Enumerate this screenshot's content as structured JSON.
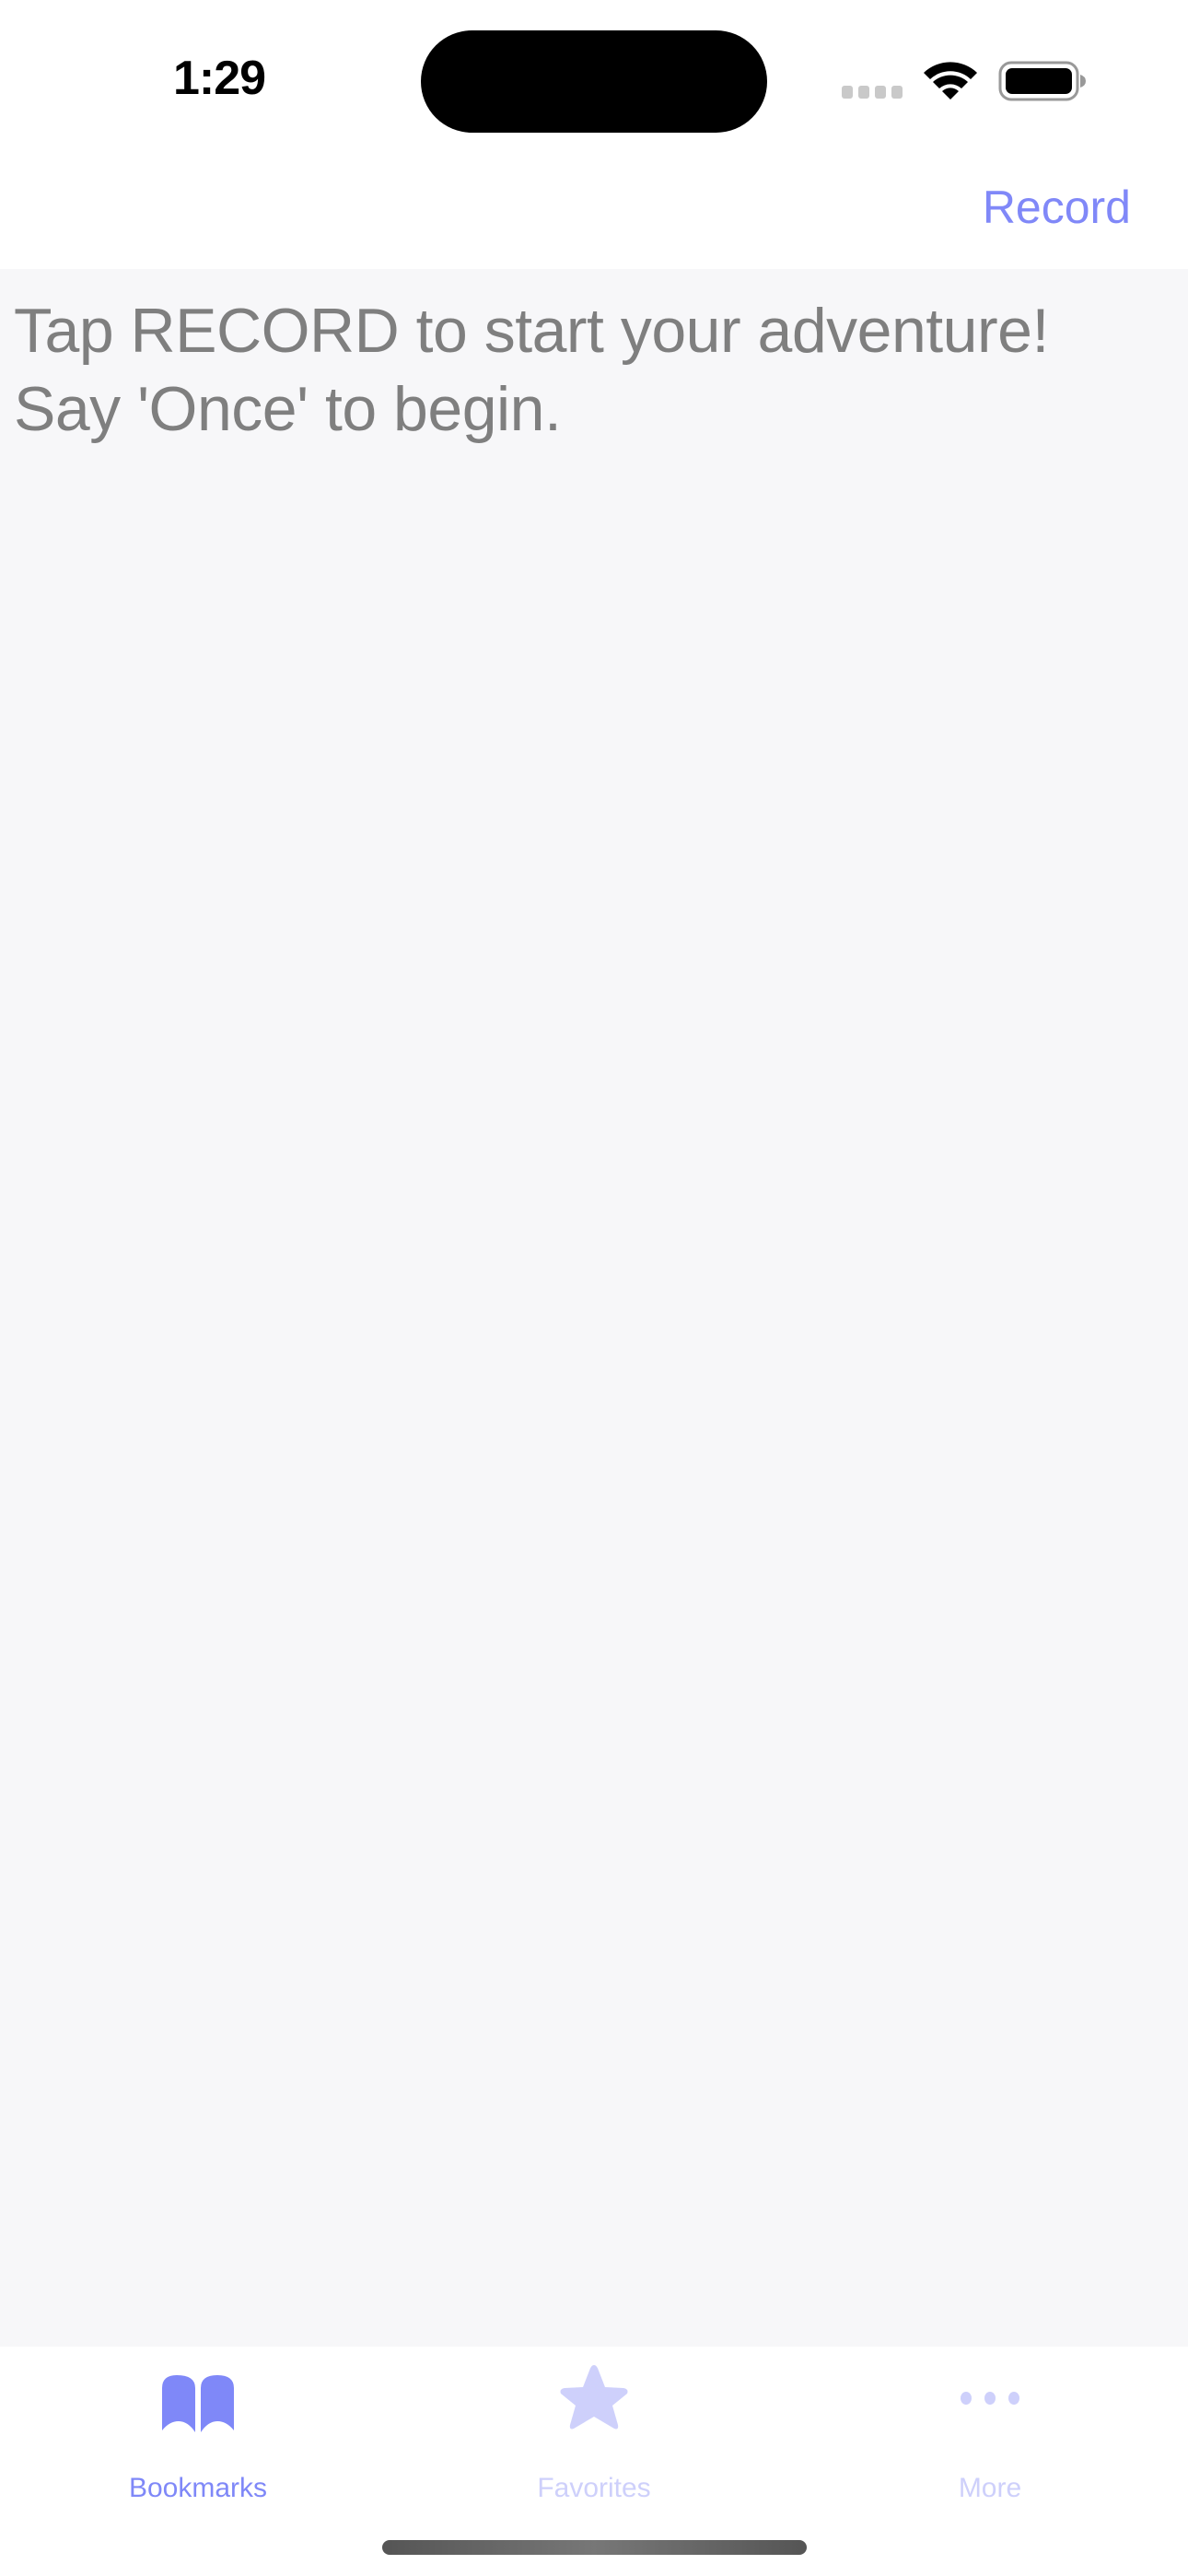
{
  "status_bar": {
    "time": "1:29",
    "icons": [
      "cellular-signal-icon",
      "wifi-icon",
      "battery-icon"
    ]
  },
  "nav_bar": {
    "record_label": "Record"
  },
  "content": {
    "message_lines": [
      "Tap RECORD to start your adventure!",
      "Say 'Once' to begin."
    ]
  },
  "tab_bar": {
    "tabs": [
      {
        "label": "Bookmarks",
        "icon": "book-icon",
        "active": true
      },
      {
        "label": "Favorites",
        "icon": "star-icon",
        "active": false
      },
      {
        "label": "More",
        "icon": "ellipsis-icon",
        "active": false
      }
    ]
  },
  "colors": {
    "accent": "#7f88f8",
    "inactive_tab": "#ced0fb",
    "message_text": "#7f7f7f",
    "content_background": "#f7f7f9"
  }
}
